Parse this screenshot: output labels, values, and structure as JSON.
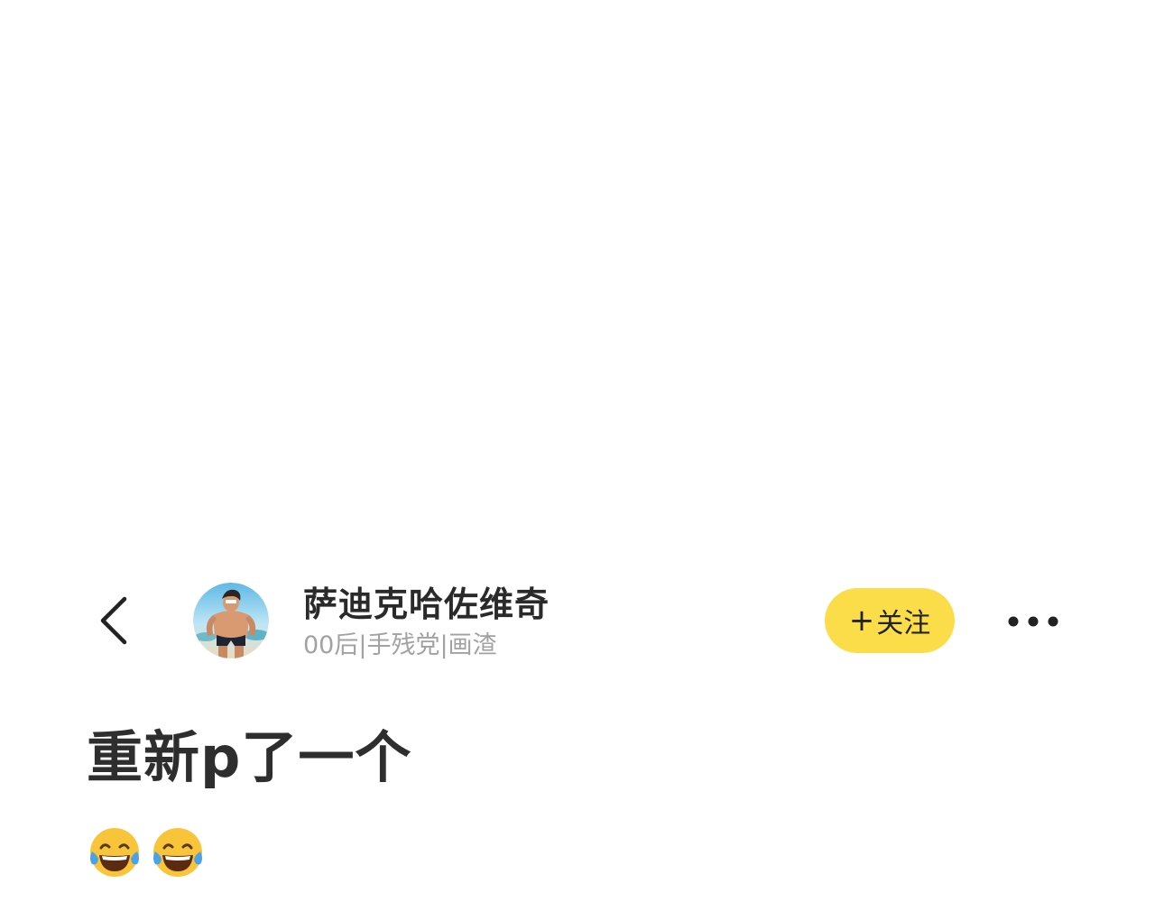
{
  "header": {
    "back_icon": "chevron-left-icon",
    "avatar_icon": "user-avatar-image",
    "username": "萨迪克哈佐维奇",
    "tags": "00后|手残党|画渣",
    "follow": {
      "plus": "+",
      "label": "关注",
      "color": "#FBDD4A"
    },
    "more_icon": "more-dots-icon"
  },
  "post": {
    "title": "重新p了一个",
    "emojis": [
      "face-with-tears-of-joy-icon",
      "face-with-tears-of-joy-icon"
    ]
  }
}
